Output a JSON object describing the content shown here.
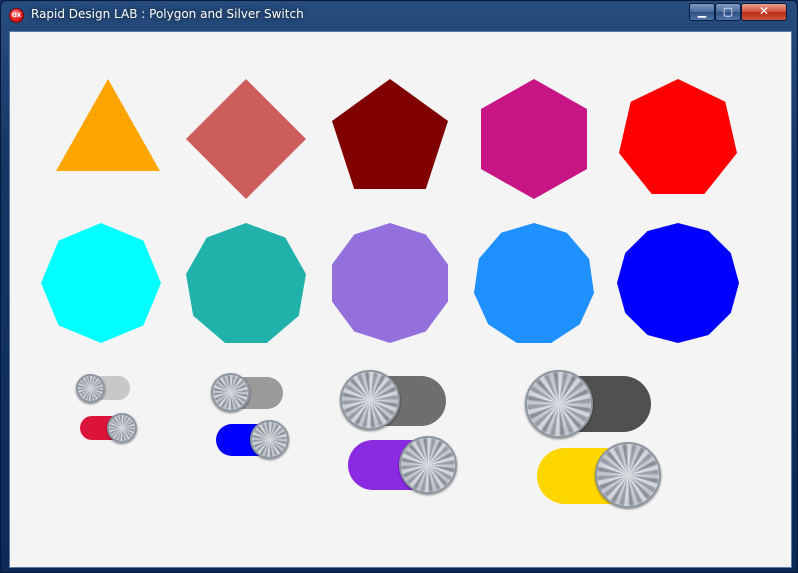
{
  "window": {
    "title": "Rapid Design LAB : Polygon and Silver Switch",
    "app_icon_text": "OX",
    "controls": {
      "minimize": "▁",
      "maximize": "▢",
      "close": "✕"
    }
  },
  "polygons": [
    {
      "sides": 3,
      "color": "#FFA500"
    },
    {
      "sides": 4,
      "color": "#CD5C5C"
    },
    {
      "sides": 5,
      "color": "#800000"
    },
    {
      "sides": 6,
      "color": "#C71585"
    },
    {
      "sides": 7,
      "color": "#FF0000"
    },
    {
      "sides": 8,
      "color": "#00FFFF"
    },
    {
      "sides": 9,
      "color": "#20B2AA"
    },
    {
      "sides": 10,
      "color": "#9370DB"
    },
    {
      "sides": 11,
      "color": "#1E90FF"
    },
    {
      "sides": 12,
      "color": "#0000FF"
    }
  ],
  "switches": [
    {
      "state": "off",
      "track_color": "#C8C8C8"
    },
    {
      "state": "on",
      "track_color": "#DC143C"
    },
    {
      "state": "off",
      "track_color": "#9A9A9A"
    },
    {
      "state": "on",
      "track_color": "#0000FF"
    },
    {
      "state": "off",
      "track_color": "#6E6E6E"
    },
    {
      "state": "on",
      "track_color": "#8A2BE2"
    },
    {
      "state": "off",
      "track_color": "#505050"
    },
    {
      "state": "on",
      "track_color": "#FFD700"
    }
  ]
}
